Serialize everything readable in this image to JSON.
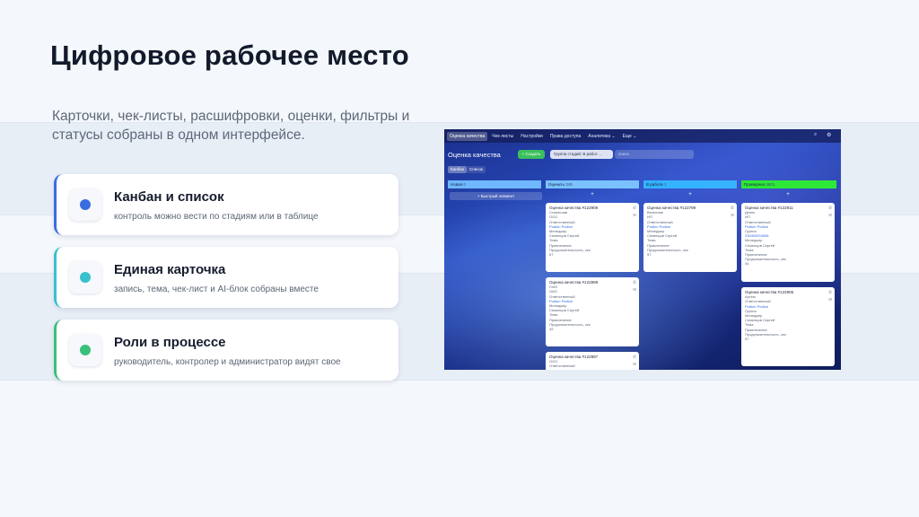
{
  "page": {
    "title": "Цифровое рабочее место",
    "subtitle": "Карточки, чек-листы, расшифровки, оценки, фильтры и статусы собраны в одном интерфейсе."
  },
  "features": [
    {
      "title": "Канбан и список",
      "desc": "контроль можно вести по стадиям или в таблице",
      "color": "#3a6de0"
    },
    {
      "title": "Единая карточка",
      "desc": "запись, тема, чек-лист и AI-блок собраны вместе",
      "color": "#38c0cc"
    },
    {
      "title": "Роли в процессе",
      "desc": "руководитель, контролер и администратор видят свое",
      "color": "#3ac07a"
    }
  ],
  "screenshot": {
    "nav": [
      "Оценка качества",
      "Чек-листы",
      "Настройки",
      "Права доступа",
      "Аналитика ⌄",
      "Еще ⌄"
    ],
    "page_title": "Оценка качества",
    "create_button": "+ Создать",
    "filter": "Группа стадий: В работ…",
    "search_placeholder": "поиск",
    "view_tabs": [
      "Канбан",
      "Список"
    ],
    "stages": [
      {
        "name": "Новая",
        "count": "0",
        "color": "#6fb8ff"
      },
      {
        "name": "Оценить",
        "count": "349",
        "color": "#7ac2ff"
      },
      {
        "name": "В работе",
        "count": "1",
        "color": "#35b3ff"
      },
      {
        "name": "Проверено",
        "count": "3601",
        "color": "#2ee838"
      }
    ],
    "quick_add": "+ Быстрый элемент",
    "cards": [
      {
        "title": "Оценка качества #122909",
        "name": "Станислав",
        "org": "ООО",
        "role_label": "Ответственный",
        "user": "Podlon Podlon",
        "mgr_label": "Менеджер",
        "mgr": "Семенцов Сергей",
        "topic_label": "Тема",
        "topic": "Привлечение",
        "dur_label": "Продолжительность, сек",
        "dur": "57"
      },
      {
        "title": "Оценка качества #122899",
        "name": "Глеб",
        "org": "ОАО",
        "role_label": "Ответственный",
        "user": "Podlon Podlon",
        "mgr_label": "Менеджер",
        "mgr": "Семенцов Сергей",
        "topic_label": "Тема",
        "topic": "Привлечение",
        "dur_label": "Продолжительность, сек",
        "dur": "49"
      },
      {
        "title": "Оценка качества #122897",
        "name": "ООО",
        "role_label": "Ответственный"
      },
      {
        "title": "Оценка качества #122799",
        "name": "Вячеслав",
        "org": "ИП",
        "role_label": "Ответственный",
        "user": "Podlon Podlon",
        "mgr_label": "Менеджер",
        "mgr": "Семенцов Сергей",
        "topic_label": "Тема",
        "topic": "Привлечение",
        "dur_label": "Продолжительность, сек",
        "dur": "57"
      },
      {
        "title": "Оценка качества #122911",
        "name": "Денис",
        "org": "ИП",
        "role_label": "Ответственный",
        "user": "Podlon Podlon",
        "mgr_label": "Группа",
        "mgr": "SXM00004598",
        "topic_label": "Менеджер",
        "topic": "Семенцов Сергей",
        "dur_label": "Тема",
        "dur": "Привлечение",
        "extra_label": "Продолжительность, сек",
        "extra": "44"
      },
      {
        "title": "Оценка качества #122906",
        "name": "Артем",
        "role_label": "Ответственный",
        "user": "Podlon Podlon",
        "mgr_label": "Группа",
        "topic_label": "Менеджер",
        "topic": "Семенцов Сергей",
        "dur_label": "Тема",
        "dur": "Привлечение",
        "extra_label": "Продолжительность, сек",
        "extra": "57"
      }
    ]
  }
}
